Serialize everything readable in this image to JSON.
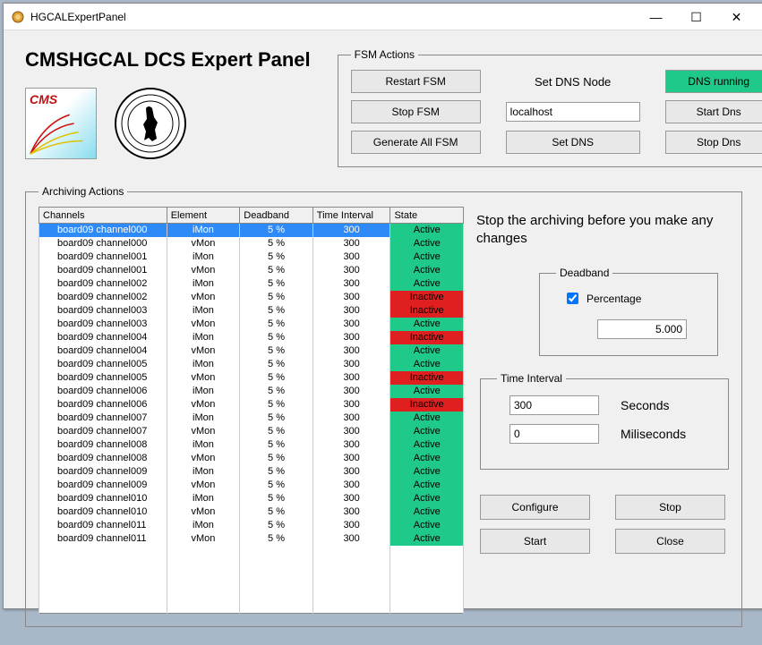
{
  "window": {
    "title": "HGCALExpertPanel"
  },
  "header": {
    "title": "CMSHGCAL DCS Expert Panel"
  },
  "fsm": {
    "legend": "FSM Actions",
    "restart": "Restart FSM",
    "stop": "Stop FSM",
    "generate": "Generate All FSM",
    "setDnsNodeLabel": "Set DNS Node",
    "dnsHost": "localhost",
    "setDns": "Set DNS",
    "dnsRunning": "DNS running",
    "startDns": "Start Dns",
    "stopDns": "Stop Dns"
  },
  "archiving": {
    "legend": "Archiving Actions",
    "columns": {
      "channels": "Channels",
      "element": "Element",
      "deadband": "Deadband",
      "timeInterval": "Time Interval",
      "state": "State"
    },
    "rows": [
      {
        "ch": "board09 channel000",
        "el": "iMon",
        "db": "5 %",
        "ti": "300",
        "st": "Active",
        "selected": true
      },
      {
        "ch": "board09 channel000",
        "el": "vMon",
        "db": "5 %",
        "ti": "300",
        "st": "Active"
      },
      {
        "ch": "board09 channel001",
        "el": "iMon",
        "db": "5 %",
        "ti": "300",
        "st": "Active"
      },
      {
        "ch": "board09 channel001",
        "el": "vMon",
        "db": "5 %",
        "ti": "300",
        "st": "Active"
      },
      {
        "ch": "board09 channel002",
        "el": "iMon",
        "db": "5 %",
        "ti": "300",
        "st": "Active"
      },
      {
        "ch": "board09 channel002",
        "el": "vMon",
        "db": "5 %",
        "ti": "300",
        "st": "Inactive"
      },
      {
        "ch": "board09 channel003",
        "el": "iMon",
        "db": "5 %",
        "ti": "300",
        "st": "Inactive"
      },
      {
        "ch": "board09 channel003",
        "el": "vMon",
        "db": "5 %",
        "ti": "300",
        "st": "Active"
      },
      {
        "ch": "board09 channel004",
        "el": "iMon",
        "db": "5 %",
        "ti": "300",
        "st": "Inactive"
      },
      {
        "ch": "board09 channel004",
        "el": "vMon",
        "db": "5 %",
        "ti": "300",
        "st": "Active"
      },
      {
        "ch": "board09 channel005",
        "el": "iMon",
        "db": "5 %",
        "ti": "300",
        "st": "Active"
      },
      {
        "ch": "board09 channel005",
        "el": "vMon",
        "db": "5 %",
        "ti": "300",
        "st": "Inactive"
      },
      {
        "ch": "board09 channel006",
        "el": "iMon",
        "db": "5 %",
        "ti": "300",
        "st": "Active"
      },
      {
        "ch": "board09 channel006",
        "el": "vMon",
        "db": "5 %",
        "ti": "300",
        "st": "Inactive"
      },
      {
        "ch": "board09 channel007",
        "el": "iMon",
        "db": "5 %",
        "ti": "300",
        "st": "Active"
      },
      {
        "ch": "board09 channel007",
        "el": "vMon",
        "db": "5 %",
        "ti": "300",
        "st": "Active"
      },
      {
        "ch": "board09 channel008",
        "el": "iMon",
        "db": "5 %",
        "ti": "300",
        "st": "Active"
      },
      {
        "ch": "board09 channel008",
        "el": "vMon",
        "db": "5 %",
        "ti": "300",
        "st": "Active"
      },
      {
        "ch": "board09 channel009",
        "el": "iMon",
        "db": "5 %",
        "ti": "300",
        "st": "Active"
      },
      {
        "ch": "board09 channel009",
        "el": "vMon",
        "db": "5 %",
        "ti": "300",
        "st": "Active"
      },
      {
        "ch": "board09 channel010",
        "el": "iMon",
        "db": "5 %",
        "ti": "300",
        "st": "Active"
      },
      {
        "ch": "board09 channel010",
        "el": "vMon",
        "db": "5 %",
        "ti": "300",
        "st": "Active"
      },
      {
        "ch": "board09 channel011",
        "el": "iMon",
        "db": "5 %",
        "ti": "300",
        "st": "Active"
      },
      {
        "ch": "board09 channel011",
        "el": "vMon",
        "db": "5 %",
        "ti": "300",
        "st": "Active"
      }
    ],
    "emptyRows": 5
  },
  "side": {
    "notice": "Stop the archiving before you make any changes",
    "deadband": {
      "legend": "Deadband",
      "percentageLabel": "Percentage",
      "value": "5.000"
    },
    "timeInterval": {
      "legend": "Time Interval",
      "seconds": "300",
      "secondsLabel": "Seconds",
      "ms": "0",
      "msLabel": "Miliseconds"
    },
    "buttons": {
      "configure": "Configure",
      "stop": "Stop",
      "start": "Start",
      "close": "Close"
    }
  }
}
